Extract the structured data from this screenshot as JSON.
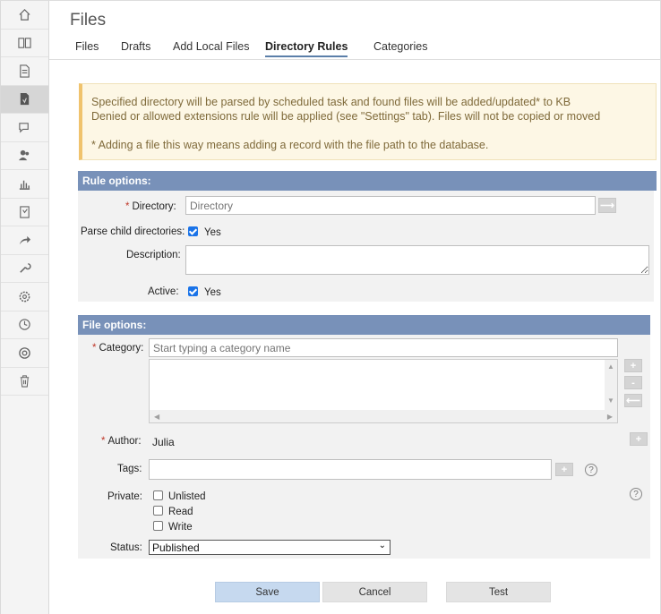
{
  "page": {
    "title": "Files"
  },
  "sidebar": {
    "items": [
      {
        "icon": "home-icon"
      },
      {
        "icon": "book-icon"
      },
      {
        "icon": "document-icon"
      },
      {
        "icon": "file-icon",
        "active": true
      },
      {
        "icon": "chat-icon"
      },
      {
        "icon": "users-icon"
      },
      {
        "icon": "bar-chart-icon"
      },
      {
        "icon": "clipboard-icon"
      },
      {
        "icon": "share-arrow-icon"
      },
      {
        "icon": "wrench-icon"
      },
      {
        "icon": "gear-icon"
      },
      {
        "icon": "history-icon"
      },
      {
        "icon": "lifebuoy-icon"
      },
      {
        "icon": "trash-icon"
      }
    ]
  },
  "tabs": [
    "Files",
    "Drafts",
    "Add Local Files",
    "Directory Rules",
    "Categories"
  ],
  "notice": {
    "line1": "Specified directory will be parsed by scheduled task and found files will be added/updated* to KB",
    "line2": "Denied or allowed extensions rule will be applied (see \"Settings\" tab). Files will not be copied or moved",
    "line3": "* Adding a file this way means adding a record with the file path to the database."
  },
  "rule_options": {
    "heading": "Rule options:",
    "directory_label": "Directory:",
    "directory_placeholder": "Directory",
    "parse_label": "Parse child directories:",
    "parse_value": "Yes",
    "description_label": "Description:",
    "active_label": "Active:",
    "active_value": "Yes"
  },
  "file_options": {
    "heading": "File options:",
    "category_label": "Category:",
    "category_placeholder": "Start typing a category name",
    "author_label": "Author:",
    "author_value": "Julia",
    "tags_label": "Tags:",
    "private_label": "Private:",
    "private_options": [
      "Unlisted",
      "Read",
      "Write"
    ],
    "status_label": "Status:",
    "status_value": "Published"
  },
  "buttons": {
    "save": "Save",
    "cancel": "Cancel",
    "test": "Test"
  },
  "colors": {
    "section_head": "#7891b9",
    "notice_bg": "#fdf7e5",
    "primary_btn": "#c6d9ef",
    "checkbox": "#1a73e8"
  }
}
